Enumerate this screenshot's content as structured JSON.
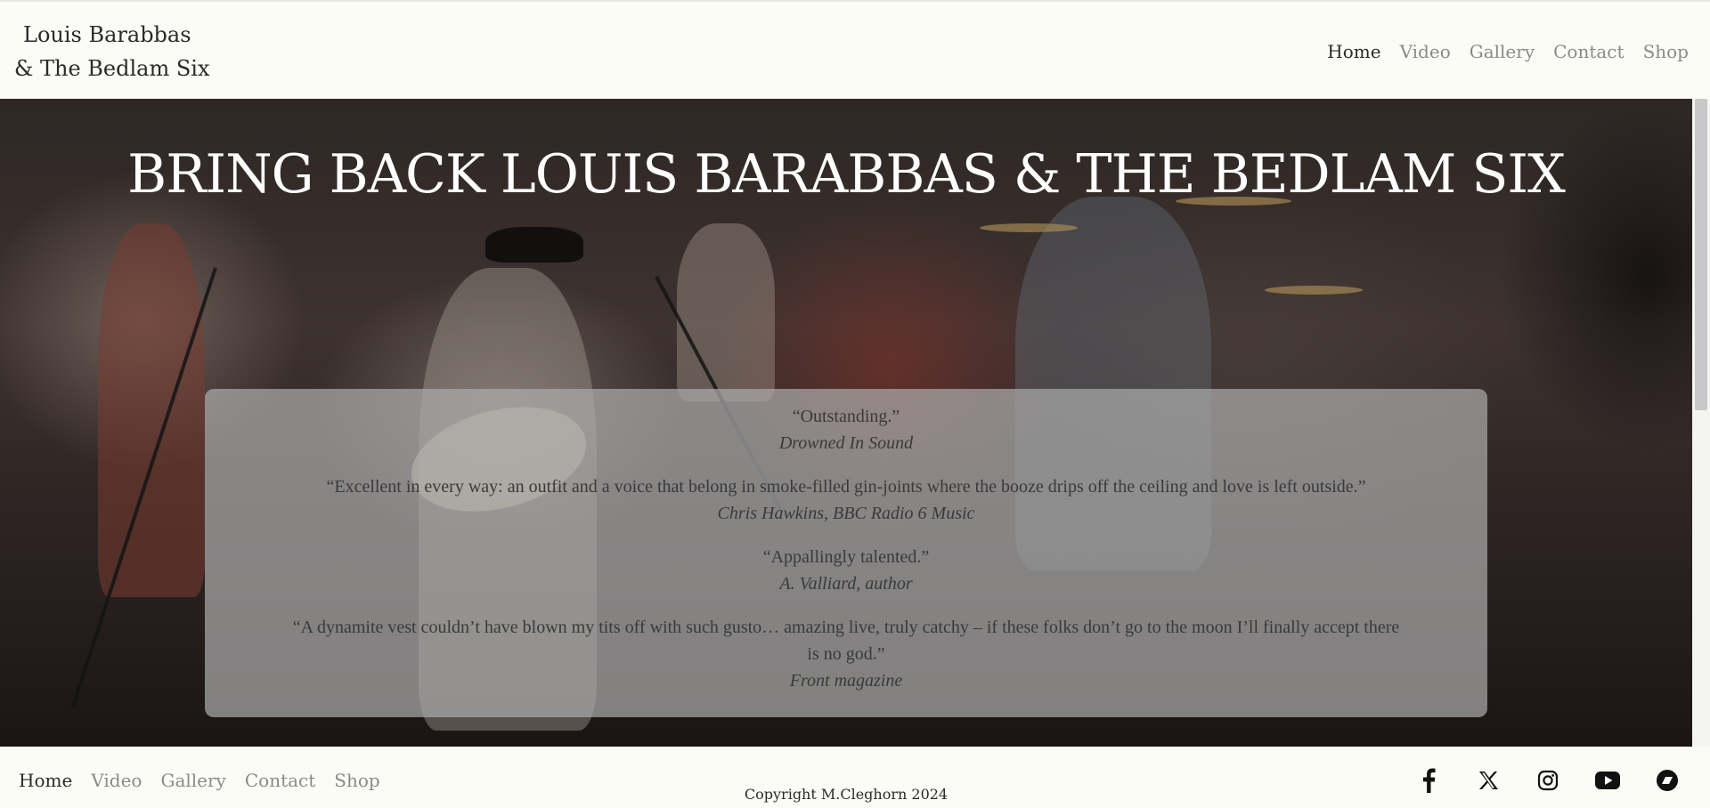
{
  "header": {
    "title_line1": "Louis Barabbas",
    "title_line2": "& The Bedlam Six",
    "nav": [
      {
        "label": "Home",
        "active": true
      },
      {
        "label": "Video",
        "active": false
      },
      {
        "label": "Gallery",
        "active": false
      },
      {
        "label": "Contact",
        "active": false
      },
      {
        "label": "Shop",
        "active": false
      }
    ]
  },
  "hero": {
    "title": "BRING BACK LOUIS BARABBAS & THE BEDLAM SIX",
    "quotes": [
      {
        "text": "“Outstanding.”",
        "source": "Drowned In Sound"
      },
      {
        "text": "“Excellent in every way: an outfit and a voice that belong in smoke-filled gin-joints where the booze drips off the ceiling and love is left outside.”",
        "source": "Chris Hawkins, BBC Radio 6 Music"
      },
      {
        "text": "“Appallingly talented.”",
        "source": "A. Valliard, author"
      },
      {
        "text": "“A dynamite vest couldn’t have blown my tits off with such gusto… amazing live, truly catchy – if these folks don’t go to the moon I’ll finally accept there is no god.”",
        "source": "Front magazine"
      }
    ]
  },
  "footer": {
    "nav": [
      {
        "label": "Home",
        "active": true
      },
      {
        "label": "Video",
        "active": false
      },
      {
        "label": "Gallery",
        "active": false
      },
      {
        "label": "Contact",
        "active": false
      },
      {
        "label": "Shop",
        "active": false
      }
    ],
    "copyright": "Copyright M.Cleghorn 2024",
    "social": [
      "facebook-icon",
      "x-twitter-icon",
      "instagram-icon",
      "youtube-icon",
      "bandcamp-icon"
    ]
  },
  "colors": {
    "background": "#fcfcf6",
    "text": "#2a2a2a",
    "nav_inactive": "#8a8a8a",
    "quote_box": "rgba(170,170,170,0.72)"
  }
}
